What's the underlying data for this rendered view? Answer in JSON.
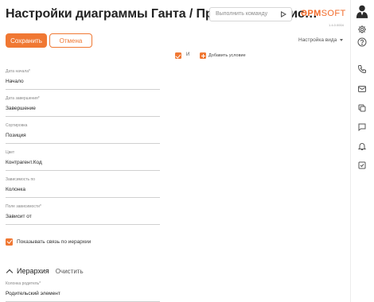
{
  "header": {
    "title": "Настройки диаграммы Ганта / Проекты (с завис…",
    "command_placeholder": "Выполнить команду",
    "logo_main": "ƏPM",
    "logo_sub": "SOFT",
    "version": "1.4.0.0004"
  },
  "toolbar": {
    "save_label": "Сохранить",
    "cancel_label": "Отмена",
    "view_settings_label": "Настройка вида"
  },
  "condition": {
    "and_label": "И",
    "add_label": "Добавить условие"
  },
  "fields": [
    {
      "label": "Дата начала*",
      "value": "Начало"
    },
    {
      "label": "Дата завершения*",
      "value": "Завершение"
    },
    {
      "label": "Сортировка",
      "value": "Позиция"
    },
    {
      "label": "Цвет",
      "value": "Контрагент.Код"
    },
    {
      "label": "Зависимость по",
      "value": "Колонка"
    },
    {
      "label": "Поле зависимости*",
      "value": "Зависит от"
    }
  ],
  "show_hierarchy_link": {
    "label": "Показывать связь по иерархии",
    "checked": true
  },
  "hierarchy": {
    "title": "Иерархия",
    "clear_label": "Очистить",
    "parent_field": {
      "label": "Колонка родитель*",
      "value": "Родительский элемент"
    }
  },
  "side_icons": [
    "user-avatar-icon",
    "settings-gear-icon",
    "help-icon",
    "phone-icon",
    "mail-icon",
    "copy-icon",
    "chat-icon",
    "bell-icon",
    "checkbox-task-icon"
  ],
  "colors": {
    "accent": "#f07833",
    "text": "#222222",
    "muted": "#888888",
    "border": "#d0d0d0"
  }
}
